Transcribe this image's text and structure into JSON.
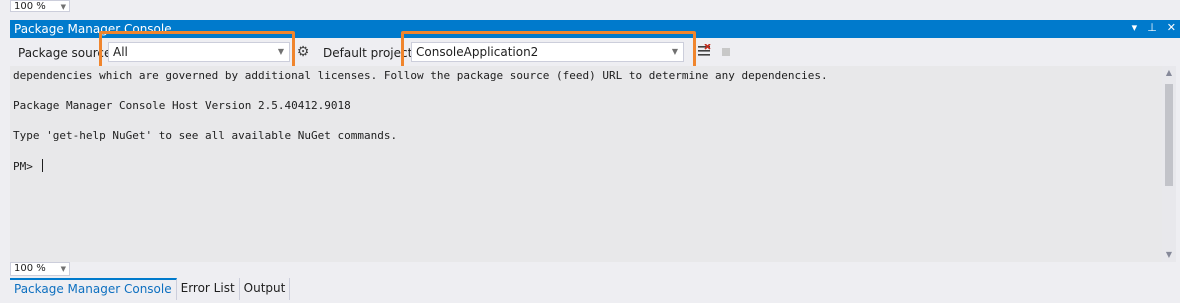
{
  "top_zoom": {
    "value": "100 %"
  },
  "window": {
    "title": "Package Manager Console",
    "controls": [
      "▾",
      "⊥",
      "✕"
    ]
  },
  "toolbar": {
    "package_source_label": "Package source",
    "package_source_value": "All",
    "default_project_label": "Default project",
    "default_project_value": "ConsoleApplication2",
    "highlight_color": "#f0852d"
  },
  "console": {
    "lines": [
      "dependencies which are governed by additional licenses. Follow the package source (feed) URL to determine any dependencies.",
      "Package Manager Console Host Version 2.5.40412.9018",
      "Type 'get-help NuGet' to see all available NuGet commands.",
      "PM> "
    ]
  },
  "bottom_zoom": {
    "value": "100 %"
  },
  "tabs": [
    {
      "label": "Package Manager Console",
      "active": true
    },
    {
      "label": "Error List",
      "active": false
    },
    {
      "label": "Output",
      "active": false
    }
  ],
  "colors": {
    "accent": "#007acc",
    "highlight": "#f0852d"
  }
}
